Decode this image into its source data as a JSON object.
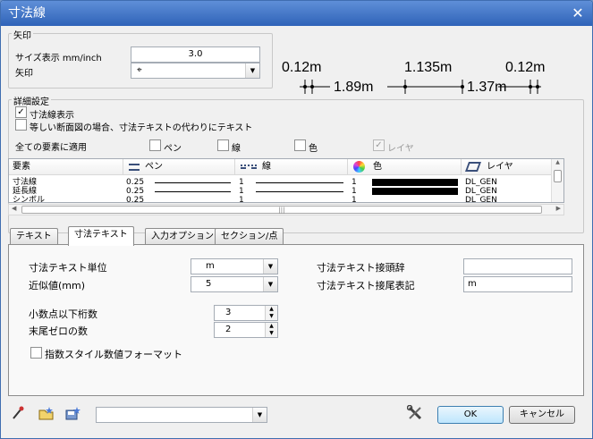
{
  "window": {
    "title": "寸法線"
  },
  "arrow_group": {
    "title": "矢印",
    "size_label": "サイズ表示 mm/inch",
    "size_value": "3.0",
    "arrow_label": "矢印",
    "arrow_symbol": "⌖"
  },
  "preview": {
    "top_left": "0.12m",
    "top_mid": "1.135m",
    "top_right": "0.12m",
    "bottom_left": "1.89m",
    "bottom_right": "1.37m"
  },
  "detail_group": {
    "title": "詳細設定",
    "show_dim": "寸法線表示",
    "show_dim_checked": "✓",
    "equal_section": "等しい断面図の場合、寸法テキストの代わりにテキスト",
    "apply_all": "全ての要素に適用",
    "apply_pen": "ペン",
    "apply_line": "線",
    "apply_color": "色",
    "apply_layer": "レイヤ",
    "apply_layer_checked": "✓"
  },
  "grid": {
    "headers": [
      "要素",
      "ペン",
      "線",
      "色",
      "レイヤ"
    ],
    "rows": [
      {
        "element": "寸法線",
        "pen": "0.25",
        "line": "1",
        "color": "1",
        "layer": "DL_GEN"
      },
      {
        "element": "延長線",
        "pen": "0.25",
        "line": "1",
        "color": "1",
        "layer": "DL_GEN"
      },
      {
        "element": "シンボル",
        "pen": "0.25",
        "line": "1",
        "color": "1",
        "layer": "DL_GEN"
      }
    ],
    "hscroll_grip": "|||",
    "vscroll_up": "▲",
    "vscroll_down": "▼",
    "hscroll_left": "◀",
    "hscroll_right": "▶"
  },
  "tabs": [
    "テキスト",
    "寸法テキスト",
    "入力オプション",
    "セクション/点"
  ],
  "dim_text": {
    "unit_label": "寸法テキスト単位",
    "unit_value": "m",
    "approx_label": "近似値(mm)",
    "approx_value": "5",
    "decimals_label": "小数点以下桁数",
    "decimals_value": "3",
    "trailing_label": "末尾ゼロの数",
    "trailing_value": "2",
    "exp_label": "指数スタイル数値フォーマット",
    "prefix_label": "寸法テキスト接頭辞",
    "prefix_value": "",
    "suffix_label": "寸法テキスト接尾表記",
    "suffix_value": "m"
  },
  "footer": {
    "preset_value": "",
    "ok": "OK",
    "cancel": "キャンセル"
  },
  "glyphs": {
    "close": "✕",
    "down": "▼",
    "up": "▲",
    "eyedropper": "⁄",
    "wrench": "✂"
  }
}
